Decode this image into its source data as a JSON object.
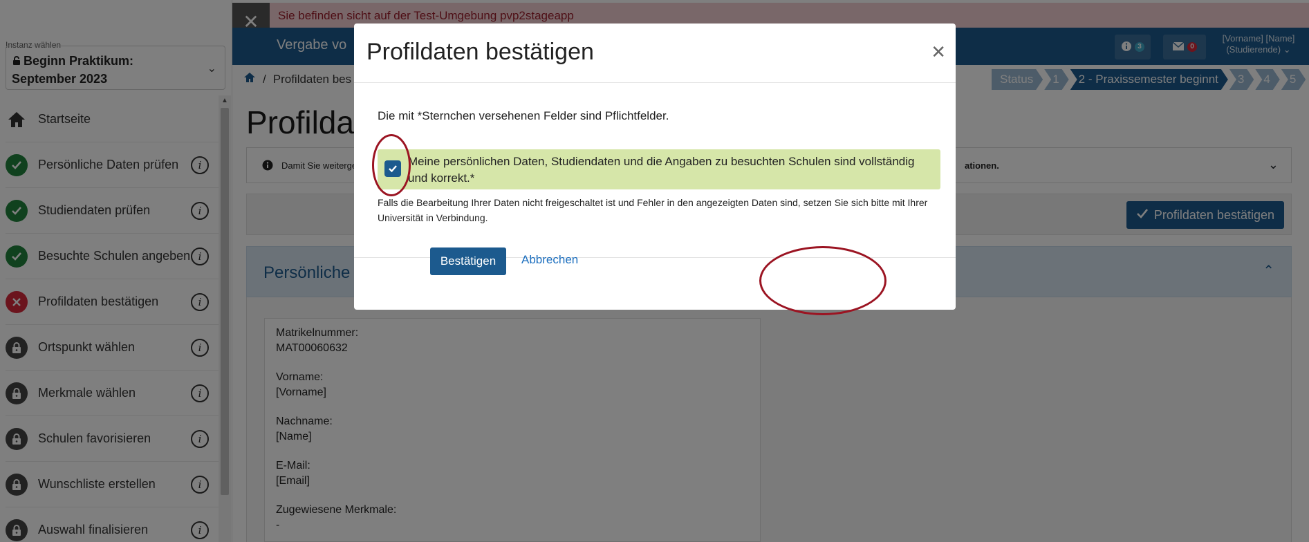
{
  "test_banner": {
    "text": "Sie befinden sicht auf der Test-Umgebung pvp2stageapp",
    "close_icon": "close-icon"
  },
  "header": {
    "title": "Vergabe vo",
    "info_count": "3",
    "mail_count": "0",
    "user_name": "[Vorname] [Name]",
    "user_role": "(Studierende)",
    "accent": "#1c5a8e"
  },
  "sidebar": {
    "instance_label": "Instanz wählen",
    "instance_value": "Beginn Praktikum: September 2023",
    "items": [
      {
        "label": "Startseite",
        "state": "home"
      },
      {
        "label": "Persönliche Daten prüfen",
        "state": "done"
      },
      {
        "label": "Studiendaten prüfen",
        "state": "done"
      },
      {
        "label": "Besuchte Schulen angeben",
        "state": "done"
      },
      {
        "label": "Profildaten bestätigen",
        "state": "error"
      },
      {
        "label": "Ortspunkt wählen",
        "state": "locked"
      },
      {
        "label": "Merkmale wählen",
        "state": "locked"
      },
      {
        "label": "Schulen favorisieren",
        "state": "locked"
      },
      {
        "label": "Wunschliste erstellen",
        "state": "locked"
      },
      {
        "label": "Auswahl finalisieren",
        "state": "locked"
      }
    ]
  },
  "breadcrumb": {
    "separator": "/",
    "current": "Profildaten bes"
  },
  "steps": [
    "Status",
    "1",
    "2 - Praxissemester beginnt",
    "3",
    "4",
    "5"
  ],
  "page": {
    "title": "Profildat",
    "info_text": "Damit Sie weiterge",
    "info_text_tail": "ationen.",
    "confirm_button": "Profildaten bestätigen",
    "section_title": "Persönliche",
    "fields": [
      {
        "label": "Matrikelnummer:",
        "value": "MAT00060632"
      },
      {
        "label": "Vorname:",
        "value": "[Vorname]"
      },
      {
        "label": "Nachname:",
        "value": "[Name]"
      },
      {
        "label": "E-Mail:",
        "value": "[Email]"
      },
      {
        "label": "Zugewiesene Merkmale:",
        "value": "-"
      }
    ]
  },
  "modal": {
    "title": "Profildaten bestätigen",
    "required_note": "Die mit *Sternchen versehenen Felder sind Pflichtfelder.",
    "consent_text": "Meine persönlichen Daten, Studiendaten und die Angaben zu besuchten Schulen sind vollständig und korrekt.*",
    "consent_checked": true,
    "hint": "Falls die Bearbeitung Ihrer Daten nicht freigeschaltet ist und Fehler in den angezeigten Daten sind, setzen Sie sich bitte mit Ihrer Universität in Verbindung.",
    "confirm_label": "Bestätigen",
    "cancel_label": "Abbrechen"
  }
}
